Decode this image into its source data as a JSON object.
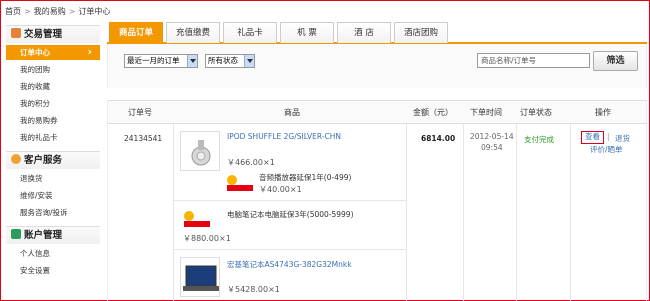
{
  "breadcrumb": {
    "home": "首页",
    "my_yigou": "我的易购",
    "current": "订单中心"
  },
  "sidebar": {
    "sections": [
      {
        "title": "交易管理",
        "icon": "clipboard-icon",
        "color": "#e8813a",
        "items": [
          "订单中心",
          "我的团购",
          "我的收藏",
          "我的积分",
          "我的易购券",
          "我的礼品卡"
        ]
      },
      {
        "title": "客户服务",
        "icon": "service-icon",
        "color": "#f0a030",
        "items": [
          "退换货",
          "维修/安装",
          "服务咨询/投诉"
        ]
      },
      {
        "title": "账户管理",
        "icon": "account-icon",
        "color": "#2e9a5e",
        "items": [
          "个人信息",
          "安全设置"
        ]
      }
    ]
  },
  "tabs": [
    "商品订单",
    "充值缴费",
    "礼品卡",
    "机  票",
    "酒  店",
    "酒店团购"
  ],
  "filters": {
    "time": "最近一月的订单",
    "status": "所有状态",
    "search_placeholder": "商品名称/订单号",
    "search_button": "筛选"
  },
  "table": {
    "headers": [
      "订单号",
      "商品",
      "金额（元）",
      "下单时间",
      "订单状态",
      "操作"
    ]
  },
  "order": {
    "id": "24134541",
    "amount": "6814.00",
    "date": "2012-05-14",
    "time": "09:54",
    "status": "支付完成",
    "actions": {
      "view": "查看",
      "sep": "|",
      "return": "退货",
      "review": "评价/晒单"
    },
    "items": [
      {
        "name": "IPOD SHUFFLE 2G/SILVER-CHN",
        "price": "￥466.00×1",
        "warranty_name": "音频播放器延保1年(0-499)",
        "warranty_price": "￥40.00×1"
      },
      {
        "warranty_name": "电脑笔记本电脑延保3年(5000-5999)",
        "warranty_price": "￥880.00×1"
      },
      {
        "name": "宏基笔记本AS4743G-382G32Mnkk",
        "price": "￥5428.00×1"
      }
    ],
    "logo_text": "阳光包"
  },
  "colors": {
    "accent": "#f39800",
    "status_green": "#2a9a2a",
    "link": "#3a6fb5",
    "border_red": "#e60012"
  }
}
